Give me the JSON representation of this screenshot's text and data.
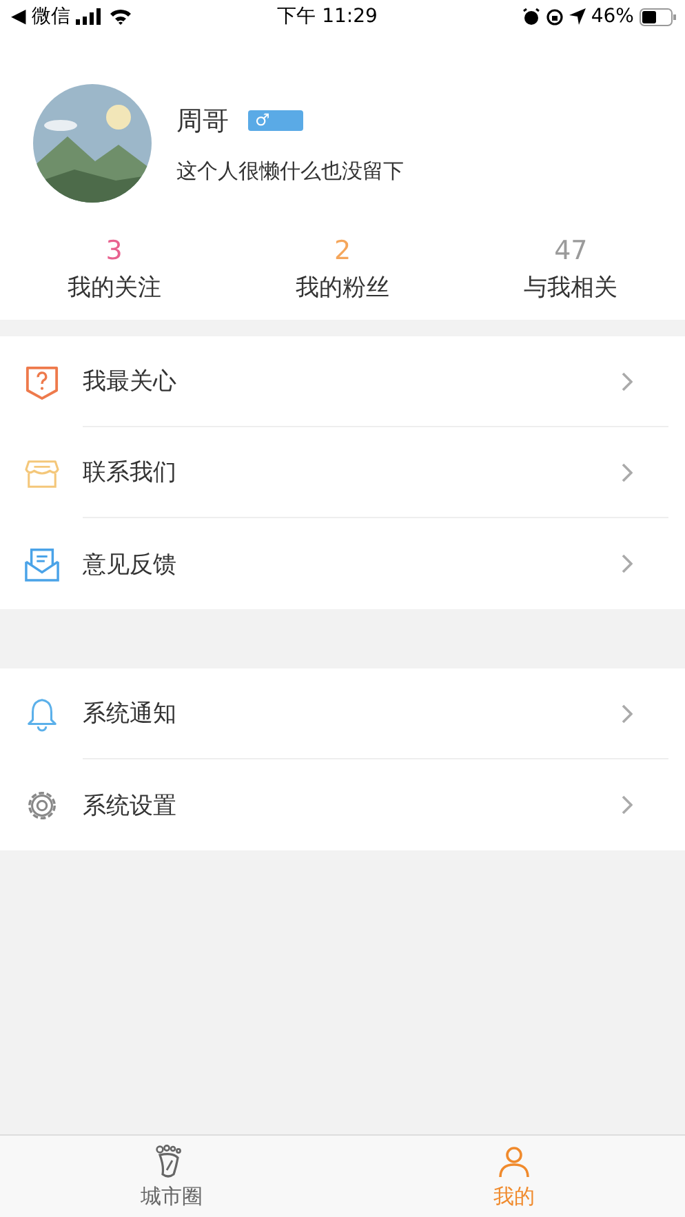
{
  "status_bar": {
    "back_app": "◀ 微信",
    "time": "下午 11:29",
    "battery": "46%"
  },
  "profile": {
    "name": "周哥",
    "gender_symbol": "♂",
    "bio": "这个人很懒什么也没留下"
  },
  "stats": [
    {
      "count": "3",
      "label": "我的关注",
      "color": "#e8628f"
    },
    {
      "count": "2",
      "label": "我的粉丝",
      "color": "#f5a65b"
    },
    {
      "count": "47",
      "label": "与我相关",
      "color": "#9a9a9a"
    }
  ],
  "menu_groups": [
    {
      "items": [
        {
          "kind": "question",
          "label": "我最关心"
        },
        {
          "kind": "shop",
          "label": "联系我们"
        },
        {
          "kind": "mail",
          "label": "意见反馈"
        }
      ]
    },
    {
      "items": [
        {
          "kind": "bell",
          "label": "系统通知"
        },
        {
          "kind": "gear",
          "label": "系统设置"
        }
      ]
    }
  ],
  "tab_bar": [
    {
      "kind": "foot",
      "label": "城市圈",
      "selected": false
    },
    {
      "kind": "person",
      "label": "我的",
      "selected": true
    }
  ]
}
